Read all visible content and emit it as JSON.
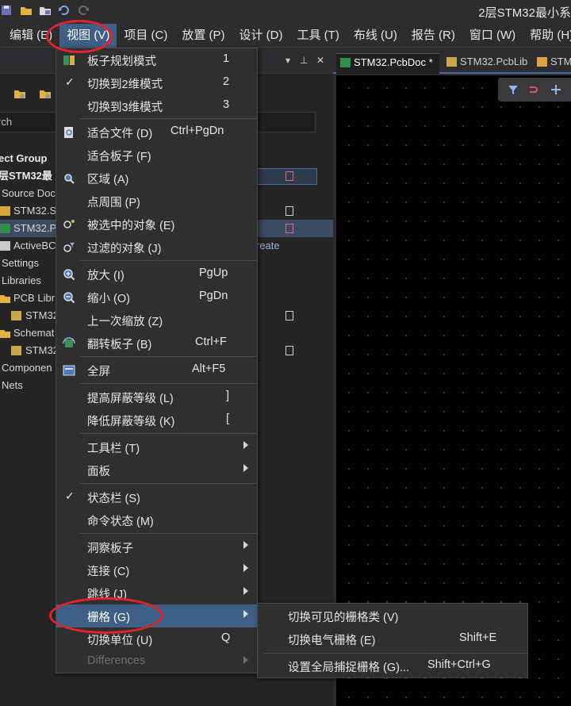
{
  "window": {
    "title": "2层STM32最小系"
  },
  "menubar": {
    "items": [
      "编辑 (E)",
      "视图 (V)",
      "项目 (C)",
      "放置 (P)",
      "设计 (D)",
      "工具 (T)",
      "布线 (U)",
      "报告 (R)",
      "窗口 (W)",
      "帮助 (H)"
    ],
    "active_index": 1
  },
  "panel": {
    "search_placeholder": "rch",
    "tree": {
      "project_group": "ect Group",
      "project": "层STM32最",
      "source_docs": "Source Doc",
      "doc1": "STM32.S",
      "doc2": "STM32.P",
      "doc3": "ActiveBC",
      "doc3_extra": "reate",
      "settings": "Settings",
      "libraries": "Libraries",
      "pcb_lib_folder": "PCB Libr",
      "pcb_lib_item": "STM32",
      "sch_lib_folder": "Schemat",
      "sch_lib_item": "STM32",
      "components": "Componen",
      "nets": "Nets"
    }
  },
  "tabs": {
    "tab1": "STM32.PcbDoc *",
    "tab2": "STM32.PcbLib",
    "tab3": "STM"
  },
  "view_menu": {
    "i0": {
      "label": "板子规划模式",
      "shortcut": "1"
    },
    "i1": {
      "label": "切换到2维模式",
      "shortcut": "2",
      "checked": true
    },
    "i2": {
      "label": "切换到3维模式",
      "shortcut": "3"
    },
    "i3": {
      "label": "适合文件 (D)",
      "shortcut": "Ctrl+PgDn"
    },
    "i4": {
      "label": "适合板子 (F)",
      "shortcut": ""
    },
    "i5": {
      "label": "区域 (A)",
      "shortcut": ""
    },
    "i6": {
      "label": "点周围 (P)",
      "shortcut": ""
    },
    "i7": {
      "label": "被选中的对象 (E)",
      "shortcut": ""
    },
    "i8": {
      "label": "过滤的对象 (J)",
      "shortcut": ""
    },
    "i9": {
      "label": "放大 (I)",
      "shortcut": "PgUp"
    },
    "i10": {
      "label": "缩小 (O)",
      "shortcut": "PgDn"
    },
    "i11": {
      "label": "上一次缩放 (Z)",
      "shortcut": ""
    },
    "i12": {
      "label": "翻转板子 (B)",
      "shortcut": "Ctrl+F"
    },
    "i13": {
      "label": "全屏",
      "shortcut": "Alt+F5"
    },
    "i14": {
      "label": "提高屏蔽等级 (L)",
      "shortcut": "]"
    },
    "i15": {
      "label": "降低屏蔽等级 (K)",
      "shortcut": "["
    },
    "i16": {
      "label": "工具栏 (T)",
      "shortcut": ""
    },
    "i17": {
      "label": "面板",
      "shortcut": ""
    },
    "i18": {
      "label": "状态栏 (S)",
      "shortcut": "",
      "checked": true
    },
    "i19": {
      "label": "命令状态 (M)",
      "shortcut": ""
    },
    "i20": {
      "label": "洞察板子",
      "shortcut": ""
    },
    "i21": {
      "label": "连接 (C)",
      "shortcut": ""
    },
    "i22": {
      "label": "跳线 (J)",
      "shortcut": ""
    },
    "i23": {
      "label": "栅格 (G)",
      "shortcut": ""
    },
    "i24": {
      "label": "切换单位 (U)",
      "shortcut": "Q"
    },
    "i25": {
      "label": "Differences",
      "shortcut": ""
    }
  },
  "grid_submenu": {
    "s0": {
      "label": "切换可见的栅格类 (V)",
      "shortcut": ""
    },
    "s1": {
      "label": "切换电气栅格 (E)",
      "shortcut": "Shift+E"
    },
    "s2": {
      "label": "设置全局捕捉栅格 (G)...",
      "shortcut": "Shift+Ctrl+G"
    }
  },
  "colors": {
    "highlight": "#3f5f86",
    "annotation": "#e5222a",
    "canvas_bg": "#000000"
  }
}
